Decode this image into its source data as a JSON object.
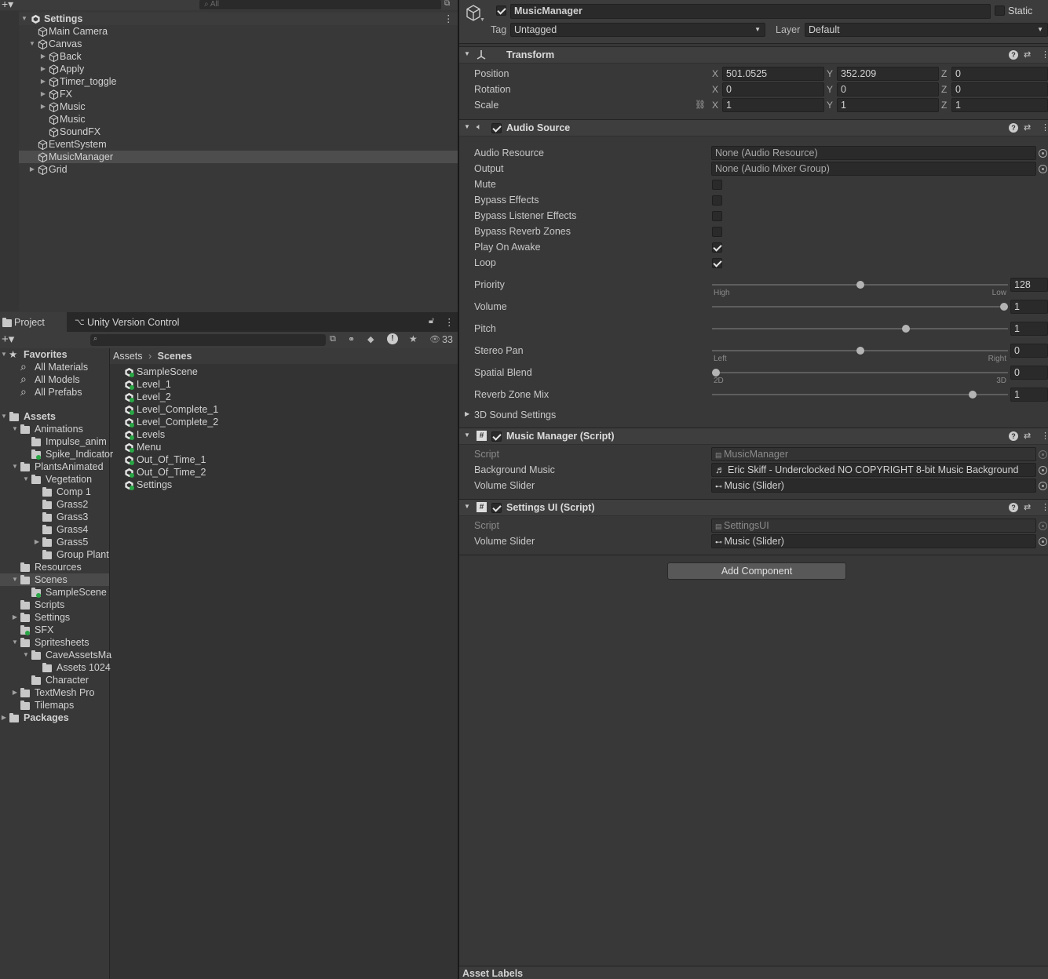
{
  "hierarchy": {
    "search_placeholder": "All",
    "scene": "Settings",
    "items": [
      {
        "label": "Main Camera"
      },
      {
        "label": "Canvas"
      },
      {
        "label": "Back"
      },
      {
        "label": "Apply"
      },
      {
        "label": "Timer_toggle"
      },
      {
        "label": "FX"
      },
      {
        "label": "Music"
      },
      {
        "label": "Music"
      },
      {
        "label": "SoundFX"
      },
      {
        "label": "EventSystem"
      },
      {
        "label": "MusicManager"
      },
      {
        "label": "Grid"
      }
    ]
  },
  "project": {
    "tabs": [
      "Project",
      "Unity Version Control"
    ],
    "hidden_count": "33",
    "favorites": {
      "label": "Favorites",
      "items": [
        "All Materials",
        "All Models",
        "All Prefabs"
      ]
    },
    "assets_root": "Assets",
    "tree": [
      "Animations",
      "Impulse_anim",
      "Spike_Indicator",
      "PlantsAnimated",
      "Vegetation",
      "Comp 1",
      "Grass2",
      "Grass3",
      "Grass4",
      "Grass5",
      "Group Plant",
      "Resources",
      "Scenes",
      "SampleScene",
      "Scripts",
      "Settings",
      "SFX",
      "Spritesheets",
      "CaveAssetsMa",
      "Assets 1024",
      "Character",
      "TextMesh Pro",
      "Tilemaps"
    ],
    "packages": "Packages",
    "breadcrumb": [
      "Assets",
      "Scenes"
    ],
    "files": [
      "SampleScene",
      "Level_1",
      "Level_2",
      "Level_Complete_1",
      "Level_Complete_2",
      "Levels",
      "Menu",
      "Out_Of_Time_1",
      "Out_Of_Time_2",
      "Settings"
    ]
  },
  "inspector": {
    "object_name": "MusicManager",
    "static_label": "Static",
    "tag_label": "Tag",
    "tag_value": "Untagged",
    "layer_label": "Layer",
    "layer_value": "Default",
    "transform": {
      "title": "Transform",
      "position_label": "Position",
      "position": {
        "x": "501.0525",
        "y": "352.209",
        "z": "0"
      },
      "rotation_label": "Rotation",
      "rotation": {
        "x": "0",
        "y": "0",
        "z": "0"
      },
      "scale_label": "Scale",
      "scale": {
        "x": "1",
        "y": "1",
        "z": "1"
      },
      "axis_x": "X",
      "axis_y": "Y",
      "axis_z": "Z"
    },
    "audio": {
      "title": "Audio Source",
      "resource_label": "Audio Resource",
      "resource_value": "None (Audio Resource)",
      "output_label": "Output",
      "output_value": "None (Audio Mixer Group)",
      "mute_label": "Mute",
      "mute": false,
      "bypass_effects_label": "Bypass Effects",
      "bypass_effects": false,
      "bypass_listener_label": "Bypass Listener Effects",
      "bypass_listener": false,
      "bypass_reverb_label": "Bypass Reverb Zones",
      "bypass_reverb": false,
      "play_on_awake_label": "Play On Awake",
      "play_on_awake": true,
      "loop_label": "Loop",
      "loop": true,
      "priority_label": "Priority",
      "priority_value": "128",
      "priority_fraction": 0.5,
      "priority_low": "High",
      "priority_high": "Low",
      "volume_label": "Volume",
      "volume_value": "1",
      "volume_fraction": 1.0,
      "pitch_label": "Pitch",
      "pitch_value": "1",
      "pitch_fraction": 0.66,
      "stereo_label": "Stereo Pan",
      "stereo_value": "0",
      "stereo_fraction": 0.5,
      "stereo_left": "Left",
      "stereo_right": "Right",
      "spatial_label": "Spatial Blend",
      "spatial_value": "0",
      "spatial_fraction": 0.0,
      "spatial_2d": "2D",
      "spatial_3d": "3D",
      "reverb_label": "Reverb Zone Mix",
      "reverb_value": "1",
      "reverb_fraction": 0.89,
      "sound_settings_label": "3D Sound Settings"
    },
    "music_manager": {
      "title": "Music Manager (Script)",
      "script_label": "Script",
      "script_value": "MusicManager",
      "bg_label": "Background Music",
      "bg_value": "Eric Skiff - Underclocked  NO COPYRIGHT 8-bit Music  Background",
      "slider_label": "Volume Slider",
      "slider_value": "Music (Slider)"
    },
    "settings_ui": {
      "title": "Settings UI (Script)",
      "script_label": "Script",
      "script_value": "SettingsUI",
      "slider_label": "Volume Slider",
      "slider_value": "Music (Slider)"
    },
    "add_component": "Add Component",
    "asset_labels": "Asset Labels"
  },
  "colors": {
    "panel": "#383838",
    "selection": "#4d4d4d",
    "accent_green": "#28a745"
  }
}
